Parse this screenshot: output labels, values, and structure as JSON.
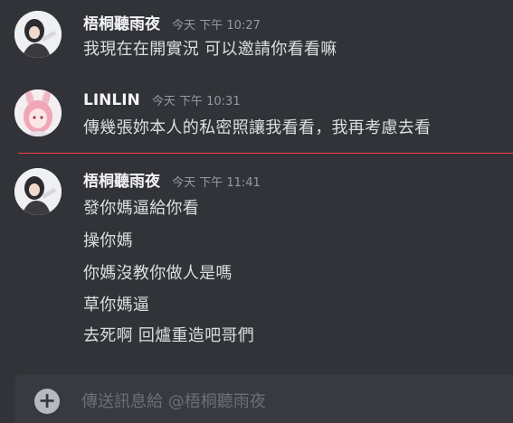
{
  "messages": [
    {
      "username": "梧桐聽雨夜",
      "timestamp": "今天 下午 10:27",
      "lines": [
        "我現在在開實況 可以邀請你看看嘛"
      ]
    },
    {
      "username": "LINLIN",
      "timestamp": "今天 下午 10:31",
      "lines": [
        "傳幾張妳本人的私密照讓我看看，我再考慮去看"
      ]
    },
    {
      "username": "梧桐聽雨夜",
      "timestamp": "今天 下午 11:41",
      "lines": [
        "發你媽逼給你看",
        "操你媽",
        "你媽沒教你做人是嗎",
        "草你媽逼",
        "去死啊 回爐重造吧哥們"
      ]
    }
  ],
  "composer": {
    "placeholder": "傳送訊息給 @梧桐聽雨夜",
    "add_icon": "plus-circle-icon"
  },
  "colors": {
    "background": "#313338",
    "new_messages_divider": "#f23f43",
    "composer_bg": "#383a40"
  }
}
